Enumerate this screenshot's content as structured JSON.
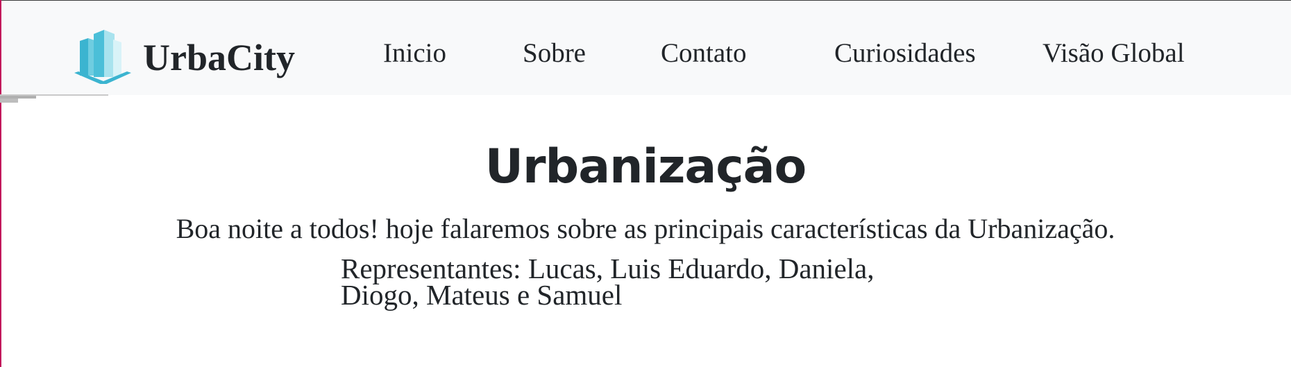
{
  "navbar": {
    "brand": {
      "name": "UrbaCity",
      "logo_icon": "city-buildings-icon",
      "logo_colors": [
        "#3bb4d0",
        "#6fcde0",
        "#a9e3ee",
        "#d9f3f8"
      ]
    },
    "links": [
      {
        "label": "Inicio"
      },
      {
        "label": "Sobre"
      },
      {
        "label": "Contato"
      },
      {
        "label": "Curiosidades"
      },
      {
        "label": "Visão Global"
      }
    ],
    "background": "#f8f9fa"
  },
  "hero": {
    "title": "Urbanização",
    "subtitle": "Boa noite a todos! hoje falaremos sobre as principais características da Urbanização.",
    "representatives_line1": "Representantes: Lucas, Luis Eduardo, Daniela,",
    "representatives_line2": "Diogo, Mateus e Samuel"
  },
  "colors": {
    "text": "#212529",
    "page_background": "#ffffff"
  }
}
